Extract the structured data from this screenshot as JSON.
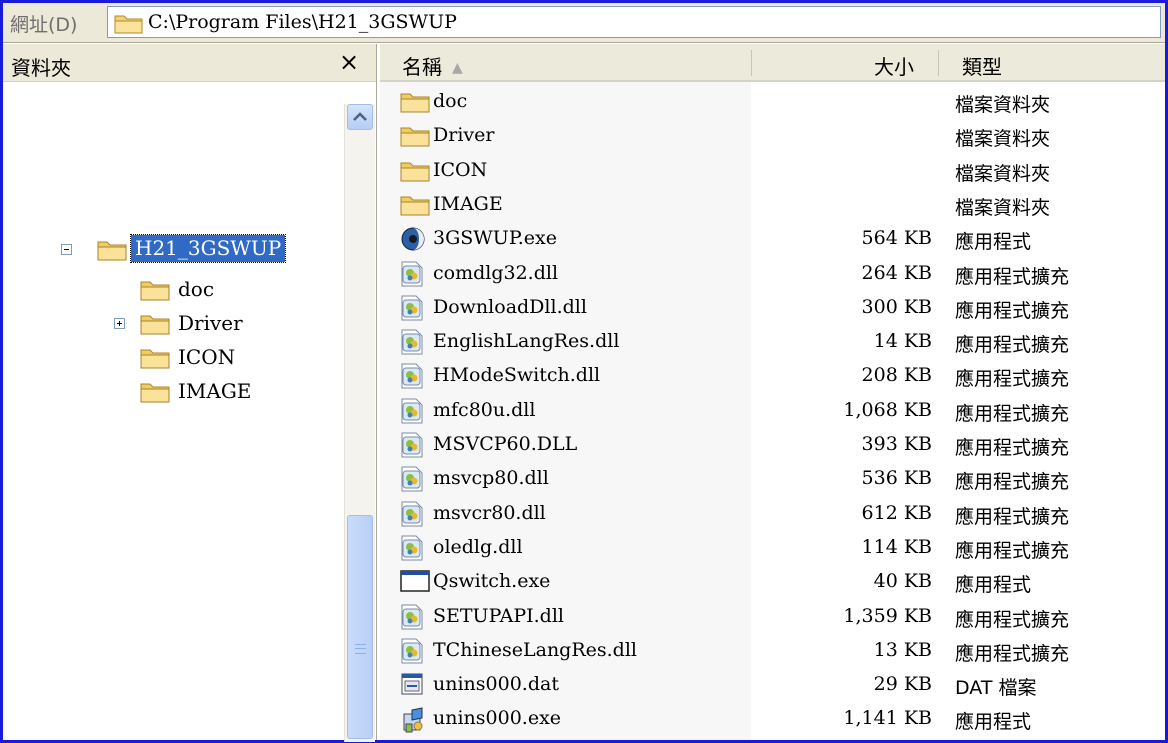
{
  "address_bar": {
    "label": "網址(D)",
    "path": "C:\\Program Files\\H21_3GSWUP"
  },
  "folders_pane": {
    "title": "資料夾",
    "close_glyph": "×",
    "tree": [
      {
        "label": "H21_3GSWUP",
        "expander": "minus",
        "selected": true
      },
      {
        "label": "doc",
        "expander": "none"
      },
      {
        "label": "Driver",
        "expander": "plus"
      },
      {
        "label": "ICON",
        "expander": "none"
      },
      {
        "label": "IMAGE",
        "expander": "none"
      }
    ]
  },
  "file_list": {
    "columns": {
      "name": "名稱",
      "size": "大小",
      "type": "類型"
    },
    "sort_arrow": "▲",
    "rows": [
      {
        "name": "doc",
        "size": "",
        "type": "檔案資料夾",
        "icon": "folder-icon"
      },
      {
        "name": "Driver",
        "size": "",
        "type": "檔案資料夾",
        "icon": "folder-icon"
      },
      {
        "name": "ICON",
        "size": "",
        "type": "檔案資料夾",
        "icon": "folder-icon"
      },
      {
        "name": "IMAGE",
        "size": "",
        "type": "檔案資料夾",
        "icon": "folder-icon"
      },
      {
        "name": "3GSWUP.exe",
        "size": "564 KB",
        "type": "應用程式",
        "icon": "app-globe-icon"
      },
      {
        "name": "comdlg32.dll",
        "size": "264 KB",
        "type": "應用程式擴充",
        "icon": "dll-icon"
      },
      {
        "name": "DownloadDll.dll",
        "size": "300 KB",
        "type": "應用程式擴充",
        "icon": "dll-icon"
      },
      {
        "name": "EnglishLangRes.dll",
        "size": "14 KB",
        "type": "應用程式擴充",
        "icon": "dll-icon"
      },
      {
        "name": "HModeSwitch.dll",
        "size": "208 KB",
        "type": "應用程式擴充",
        "icon": "dll-icon"
      },
      {
        "name": "mfc80u.dll",
        "size": "1,068 KB",
        "type": "應用程式擴充",
        "icon": "dll-icon"
      },
      {
        "name": "MSVCP60.DLL",
        "size": "393 KB",
        "type": "應用程式擴充",
        "icon": "dll-icon"
      },
      {
        "name": "msvcp80.dll",
        "size": "536 KB",
        "type": "應用程式擴充",
        "icon": "dll-icon"
      },
      {
        "name": "msvcr80.dll",
        "size": "612 KB",
        "type": "應用程式擴充",
        "icon": "dll-icon"
      },
      {
        "name": "oledlg.dll",
        "size": "114 KB",
        "type": "應用程式擴充",
        "icon": "dll-icon"
      },
      {
        "name": "Qswitch.exe",
        "size": "40 KB",
        "type": "應用程式",
        "icon": "window-app-icon"
      },
      {
        "name": "SETUPAPI.dll",
        "size": "1,359 KB",
        "type": "應用程式擴充",
        "icon": "dll-icon"
      },
      {
        "name": "TChineseLangRes.dll",
        "size": "13 KB",
        "type": "應用程式擴充",
        "icon": "dll-icon"
      },
      {
        "name": "unins000.dat",
        "size": "29 KB",
        "type": "DAT 檔案",
        "icon": "dat-file-icon"
      },
      {
        "name": "unins000.exe",
        "size": "1,141 KB",
        "type": "應用程式",
        "icon": "installer-icon"
      }
    ]
  }
}
